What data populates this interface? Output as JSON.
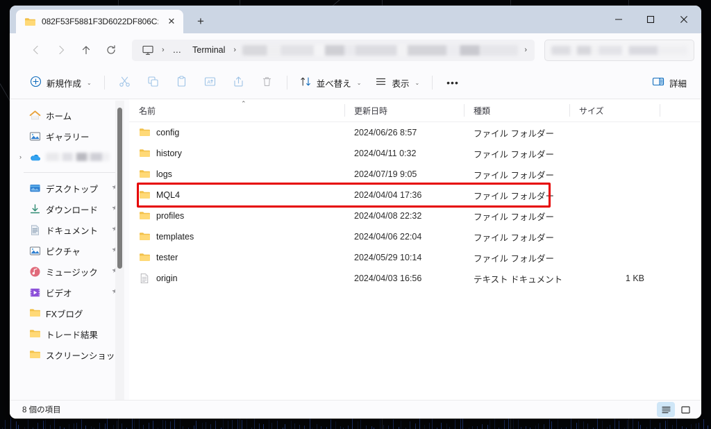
{
  "window": {
    "tab": {
      "title": "082F53F5881F3D6022DF806C:",
      "icon": "folder-icon",
      "close_label": "✕"
    },
    "new_tab_label": "+",
    "controls": {
      "minimize": "─",
      "maximize": "☐",
      "close": "✕"
    }
  },
  "address": {
    "back_label": "←",
    "forward_label": "→",
    "up_label": "↑",
    "refresh_label": "⟳",
    "breadcrumbs": [
      {
        "label": "",
        "icon": "this-pc-icon"
      },
      {
        "label": "…",
        "icon": "overflow-icon"
      },
      {
        "label": "Terminal",
        "icon": ""
      },
      {
        "label": "",
        "icon": "blurred-folder"
      }
    ],
    "separator": "›",
    "search_placeholder": ""
  },
  "toolbar": {
    "new_label": "新規作成",
    "new_icon": "plus-circle-icon",
    "cut_icon": "scissors-icon",
    "copy_icon": "copy-icon",
    "paste_icon": "clipboard-icon",
    "rename_icon": "rename-icon",
    "share_icon": "share-icon",
    "delete_icon": "trash-icon",
    "sort_label": "並べ替え",
    "sort_icon": "sort-icon",
    "view_label": "表示",
    "view_icon": "list-icon",
    "more_label": "•••",
    "details_label": "詳細",
    "details_icon": "details-pane-icon",
    "caret": "⌄"
  },
  "sidebar": {
    "items": [
      {
        "label": "ホーム",
        "icon": "home-icon",
        "pinned": false,
        "chevron": false,
        "blurred": false
      },
      {
        "label": "ギャラリー",
        "icon": "gallery-icon",
        "pinned": false,
        "chevron": false,
        "blurred": false
      },
      {
        "label": "",
        "icon": "onedrive-icon",
        "pinned": false,
        "chevron": true,
        "blurred": true
      },
      {
        "label": "デスクトップ",
        "icon": "desktop-icon",
        "pinned": true,
        "chevron": false,
        "blurred": false
      },
      {
        "label": "ダウンロード",
        "icon": "downloads-icon",
        "pinned": true,
        "chevron": false,
        "blurred": false
      },
      {
        "label": "ドキュメント",
        "icon": "documents-icon",
        "pinned": true,
        "chevron": false,
        "blurred": false
      },
      {
        "label": "ピクチャ",
        "icon": "pictures-icon",
        "pinned": true,
        "chevron": false,
        "blurred": false
      },
      {
        "label": "ミュージック",
        "icon": "music-icon",
        "pinned": true,
        "chevron": false,
        "blurred": false
      },
      {
        "label": "ビデオ",
        "icon": "videos-icon",
        "pinned": true,
        "chevron": false,
        "blurred": false
      },
      {
        "label": "FXブログ",
        "icon": "folder-icon",
        "pinned": false,
        "chevron": false,
        "blurred": false
      },
      {
        "label": "トレード結果",
        "icon": "folder-icon",
        "pinned": false,
        "chevron": false,
        "blurred": false
      },
      {
        "label": "スクリーンショット",
        "icon": "folder-icon",
        "pinned": false,
        "chevron": false,
        "blurred": false
      }
    ],
    "chevron_glyph": "›",
    "pin_glyph": "📌"
  },
  "filelist": {
    "columns": [
      {
        "key": "name",
        "label": "名前"
      },
      {
        "key": "date",
        "label": "更新日時"
      },
      {
        "key": "type",
        "label": "種類"
      },
      {
        "key": "size",
        "label": "サイズ"
      }
    ],
    "sort_indicator": "⌃",
    "rows": [
      {
        "name": "config",
        "date": "2024/06/26 8:57",
        "type": "ファイル フォルダー",
        "size": "",
        "icon": "folder-icon",
        "highlighted": false
      },
      {
        "name": "history",
        "date": "2024/04/11 0:32",
        "type": "ファイル フォルダー",
        "size": "",
        "icon": "folder-icon",
        "highlighted": false
      },
      {
        "name": "logs",
        "date": "2024/07/19 9:05",
        "type": "ファイル フォルダー",
        "size": "",
        "icon": "folder-icon",
        "highlighted": false
      },
      {
        "name": "MQL4",
        "date": "2024/04/04 17:36",
        "type": "ファイル フォルダー",
        "size": "",
        "icon": "folder-icon",
        "highlighted": true
      },
      {
        "name": "profiles",
        "date": "2024/04/08 22:32",
        "type": "ファイル フォルダー",
        "size": "",
        "icon": "folder-icon",
        "highlighted": false
      },
      {
        "name": "templates",
        "date": "2024/04/06 22:04",
        "type": "ファイル フォルダー",
        "size": "",
        "icon": "folder-icon",
        "highlighted": false
      },
      {
        "name": "tester",
        "date": "2024/05/29 10:14",
        "type": "ファイル フォルダー",
        "size": "",
        "icon": "folder-icon",
        "highlighted": false
      },
      {
        "name": "origin",
        "date": "2024/04/03 16:56",
        "type": "テキスト ドキュメント",
        "size": "1 KB",
        "icon": "text-file-icon",
        "highlighted": false
      }
    ]
  },
  "statusbar": {
    "item_count": "8 個の項目",
    "view_details_icon": "details-view-icon",
    "view_large_icon": "large-icons-view-icon"
  },
  "colors": {
    "highlight_red": "#e60000",
    "folder_yellow": "#f6c344",
    "accent_blue": "#0f6cbd",
    "titlebar": "#ccd6e4",
    "backdrop": "#050608"
  }
}
